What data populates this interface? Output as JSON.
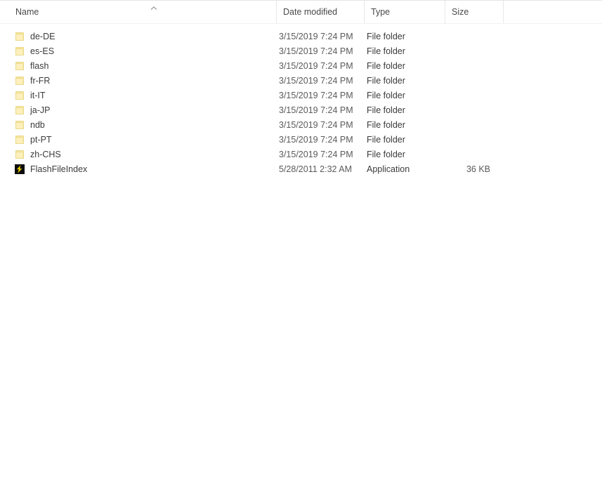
{
  "view": {
    "kind": "file-list-details-view"
  },
  "columns": [
    {
      "key": "name",
      "label": "Name",
      "sorted": true,
      "sort_direction": "ascending"
    },
    {
      "key": "date",
      "label": "Date modified",
      "sorted": false,
      "sort_direction": ""
    },
    {
      "key": "type",
      "label": "Type",
      "sorted": false,
      "sort_direction": ""
    },
    {
      "key": "size",
      "label": "Size",
      "sorted": false,
      "sort_direction": ""
    }
  ],
  "sort_indicator_glyph": "chevron-up",
  "colors": {
    "background": "#ffffff",
    "header_text": "#48484a",
    "row_text": "#3b3b3b",
    "secondary_text": "#5a5a5a",
    "separator": "#e8e8e8",
    "folder_icon": "#fbe9a0",
    "flash_icon_background": "#0b0b0b",
    "flash_icon_bolt": "#ffe400",
    "hover_row": "#f2f8fd"
  },
  "rows": [
    {
      "icon": "folder-icon",
      "name": "de-DE",
      "date": "3/15/2019 7:24 PM",
      "type": "File folder",
      "size": ""
    },
    {
      "icon": "folder-icon",
      "name": "es-ES",
      "date": "3/15/2019 7:24 PM",
      "type": "File folder",
      "size": ""
    },
    {
      "icon": "folder-icon",
      "name": "flash",
      "date": "3/15/2019 7:24 PM",
      "type": "File folder",
      "size": ""
    },
    {
      "icon": "folder-icon",
      "name": "fr-FR",
      "date": "3/15/2019 7:24 PM",
      "type": "File folder",
      "size": ""
    },
    {
      "icon": "folder-icon",
      "name": "it-IT",
      "date": "3/15/2019 7:24 PM",
      "type": "File folder",
      "size": ""
    },
    {
      "icon": "folder-icon",
      "name": "ja-JP",
      "date": "3/15/2019 7:24 PM",
      "type": "File folder",
      "size": ""
    },
    {
      "icon": "folder-icon",
      "name": "ndb",
      "date": "3/15/2019 7:24 PM",
      "type": "File folder",
      "size": ""
    },
    {
      "icon": "folder-icon",
      "name": "pt-PT",
      "date": "3/15/2019 7:24 PM",
      "type": "File folder",
      "size": ""
    },
    {
      "icon": "folder-icon",
      "name": "zh-CHS",
      "date": "3/15/2019 7:24 PM",
      "type": "File folder",
      "size": ""
    },
    {
      "icon": "flash-icon",
      "name": "FlashFileIndex",
      "date": "5/28/2011 2:32 AM",
      "type": "Application",
      "size": "36 KB"
    }
  ]
}
